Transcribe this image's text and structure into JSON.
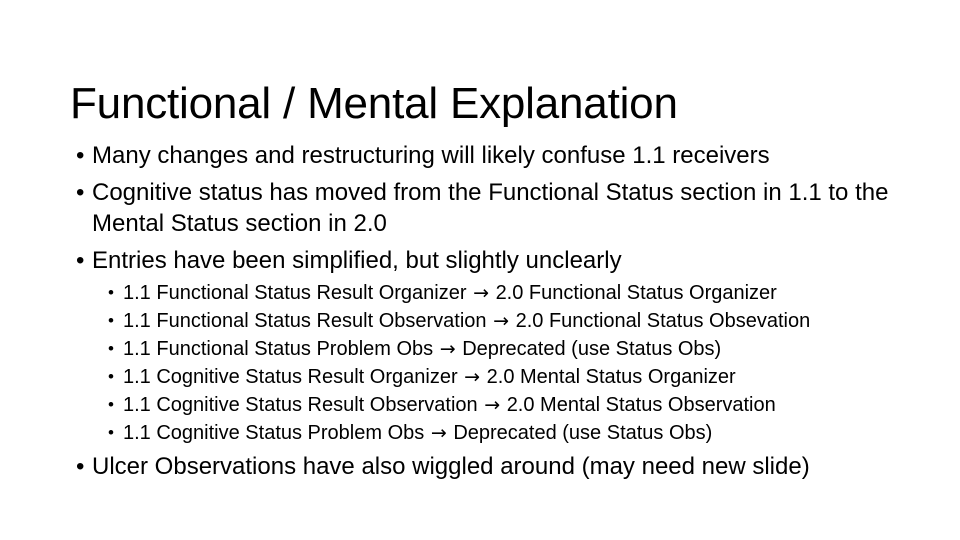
{
  "slide": {
    "title": "Functional / Mental Explanation",
    "background_color": "#ffffff",
    "text_color": "#000000",
    "bullet_glyph": "•",
    "arrow_glyph": "→",
    "bullets": [
      {
        "level": 1,
        "text": "Many changes and restructuring will likely confuse 1.1 receivers"
      },
      {
        "level": 1,
        "text": "Cognitive status has moved from the Functional Status section in 1.1 to the Mental Status section in 2.0"
      },
      {
        "level": 1,
        "text": "Entries have been simplified, but slightly unclearly"
      },
      {
        "level": 2,
        "from": "1.1 Functional Status Result Organizer",
        "to": "2.0 Functional Status Organizer"
      },
      {
        "level": 2,
        "from": "1.1 Functional Status Result Observation",
        "to": "2.0 Functional Status Obsevation"
      },
      {
        "level": 2,
        "from": "1.1 Functional Status Problem Obs",
        "to": "Deprecated (use Status Obs)"
      },
      {
        "level": 2,
        "from": "1.1 Cognitive Status Result Organizer",
        "to": "2.0 Mental Status Organizer"
      },
      {
        "level": 2,
        "from": "1.1 Cognitive Status Result Observation",
        "to": "2.0 Mental Status Observation"
      },
      {
        "level": 2,
        "from": "1.1 Cognitive Status Problem Obs",
        "to": "Deprecated (use Status Obs)"
      },
      {
        "level": 1,
        "text": "Ulcer Observations have also wiggled around (may need new slide)"
      }
    ]
  }
}
